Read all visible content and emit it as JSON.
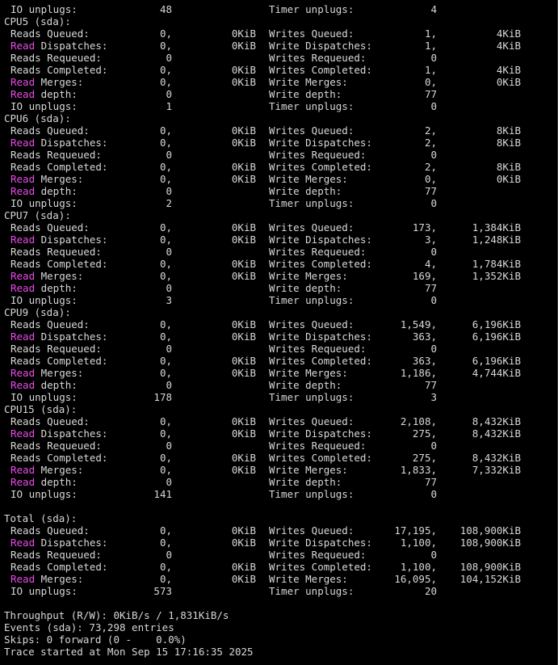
{
  "colors": {
    "background": "#000000",
    "text": "#d8d8d8",
    "highlight": "#e84be8"
  },
  "top_line": {
    "left_label": "IO unplugs:",
    "left_value": "48",
    "right_label": "Timer unplugs:",
    "right_value": "4"
  },
  "cpu_blocks": [
    {
      "header": "CPU5 (sda):",
      "rows": [
        {
          "lead": "Reads Queued:",
          "v": "0,",
          "s": "0KiB",
          "wlabel": "Writes Queued:",
          "wv": "1,",
          "ws": "4KiB"
        },
        {
          "hl": "Read",
          "lead": " Dispatches:",
          "v": "0,",
          "s": "0KiB",
          "wlabel": "Write Dispatches:",
          "wv": "1,",
          "ws": "4KiB"
        },
        {
          "lead": "Reads Requeued:",
          "v": "0",
          "s": "",
          "wlabel": "Writes Requeued:",
          "wv": "0",
          "ws": ""
        },
        {
          "lead": "Reads Completed:",
          "v": "0,",
          "s": "0KiB",
          "wlabel": "Writes Completed:",
          "wv": "1,",
          "ws": "4KiB"
        },
        {
          "hl": "Read",
          "lead": " Merges:",
          "v": "0,",
          "s": "0KiB",
          "wlabel": "Write Merges:",
          "wv": "0,",
          "ws": "0KiB"
        },
        {
          "hl": "Read",
          "lead": " depth:",
          "v": "0",
          "s": "",
          "wlabel": "Write depth:",
          "wv": "77",
          "ws": ""
        },
        {
          "lead": "IO unplugs:",
          "v": "1",
          "s": "",
          "wlabel": "Timer unplugs:",
          "wv": "0",
          "ws": ""
        }
      ]
    },
    {
      "header": "CPU6 (sda):",
      "rows": [
        {
          "lead": "Reads Queued:",
          "v": "0,",
          "s": "0KiB",
          "wlabel": "Writes Queued:",
          "wv": "2,",
          "ws": "8KiB"
        },
        {
          "hl": "Read",
          "lead": " Dispatches:",
          "v": "0,",
          "s": "0KiB",
          "wlabel": "Write Dispatches:",
          "wv": "2,",
          "ws": "8KiB"
        },
        {
          "lead": "Reads Requeued:",
          "v": "0",
          "s": "",
          "wlabel": "Writes Requeued:",
          "wv": "0",
          "ws": ""
        },
        {
          "lead": "Reads Completed:",
          "v": "0,",
          "s": "0KiB",
          "wlabel": "Writes Completed:",
          "wv": "2,",
          "ws": "8KiB"
        },
        {
          "hl": "Read",
          "lead": " Merges:",
          "v": "0,",
          "s": "0KiB",
          "wlabel": "Write Merges:",
          "wv": "0,",
          "ws": "0KiB"
        },
        {
          "hl": "Read",
          "lead": " depth:",
          "v": "0",
          "s": "",
          "wlabel": "Write depth:",
          "wv": "77",
          "ws": ""
        },
        {
          "lead": "IO unplugs:",
          "v": "2",
          "s": "",
          "wlabel": "Timer unplugs:",
          "wv": "0",
          "ws": ""
        }
      ]
    },
    {
      "header": "CPU7 (sda):",
      "rows": [
        {
          "lead": "Reads Queued:",
          "v": "0,",
          "s": "0KiB",
          "wlabel": "Writes Queued:",
          "wv": "173,",
          "ws": "1,384KiB"
        },
        {
          "hl": "Read",
          "lead": " Dispatches:",
          "v": "0,",
          "s": "0KiB",
          "wlabel": "Write Dispatches:",
          "wv": "3,",
          "ws": "1,248KiB"
        },
        {
          "lead": "Reads Requeued:",
          "v": "0",
          "s": "",
          "wlabel": "Writes Requeued:",
          "wv": "0",
          "ws": ""
        },
        {
          "lead": "Reads Completed:",
          "v": "0,",
          "s": "0KiB",
          "wlabel": "Writes Completed:",
          "wv": "4,",
          "ws": "1,784KiB"
        },
        {
          "hl": "Read",
          "lead": " Merges:",
          "v": "0,",
          "s": "0KiB",
          "wlabel": "Write Merges:",
          "wv": "169,",
          "ws": "1,352KiB"
        },
        {
          "hl": "Read",
          "lead": " depth:",
          "v": "0",
          "s": "",
          "wlabel": "Write depth:",
          "wv": "77",
          "ws": ""
        },
        {
          "lead": "IO unplugs:",
          "v": "3",
          "s": "",
          "wlabel": "Timer unplugs:",
          "wv": "0",
          "ws": ""
        }
      ]
    },
    {
      "header": "CPU9 (sda):",
      "rows": [
        {
          "lead": "Reads Queued:",
          "v": "0,",
          "s": "0KiB",
          "wlabel": "Writes Queued:",
          "wv": "1,549,",
          "ws": "6,196KiB"
        },
        {
          "hl": "Read",
          "lead": " Dispatches:",
          "v": "0,",
          "s": "0KiB",
          "wlabel": "Write Dispatches:",
          "wv": "363,",
          "ws": "6,196KiB"
        },
        {
          "lead": "Reads Requeued:",
          "v": "0",
          "s": "",
          "wlabel": "Writes Requeued:",
          "wv": "0",
          "ws": ""
        },
        {
          "lead": "Reads Completed:",
          "v": "0,",
          "s": "0KiB",
          "wlabel": "Writes Completed:",
          "wv": "363,",
          "ws": "6,196KiB"
        },
        {
          "hl": "Read",
          "lead": " Merges:",
          "v": "0,",
          "s": "0KiB",
          "wlabel": "Write Merges:",
          "wv": "1,186,",
          "ws": "4,744KiB"
        },
        {
          "hl": "Read",
          "lead": " depth:",
          "v": "0",
          "s": "",
          "wlabel": "Write depth:",
          "wv": "77",
          "ws": ""
        },
        {
          "lead": "IO unplugs:",
          "v": "178",
          "s": "",
          "wlabel": "Timer unplugs:",
          "wv": "3",
          "ws": ""
        }
      ]
    },
    {
      "header": "CPU15 (sda):",
      "rows": [
        {
          "lead": "Reads Queued:",
          "v": "0,",
          "s": "0KiB",
          "wlabel": "Writes Queued:",
          "wv": "2,108,",
          "ws": "8,432KiB"
        },
        {
          "hl": "Read",
          "lead": " Dispatches:",
          "v": "0,",
          "s": "0KiB",
          "wlabel": "Write Dispatches:",
          "wv": "275,",
          "ws": "8,432KiB"
        },
        {
          "lead": "Reads Requeued:",
          "v": "0",
          "s": "",
          "wlabel": "Writes Requeued:",
          "wv": "0",
          "ws": ""
        },
        {
          "lead": "Reads Completed:",
          "v": "0,",
          "s": "0KiB",
          "wlabel": "Writes Completed:",
          "wv": "275,",
          "ws": "8,432KiB"
        },
        {
          "hl": "Read",
          "lead": " Merges:",
          "v": "0,",
          "s": "0KiB",
          "wlabel": "Write Merges:",
          "wv": "1,833,",
          "ws": "7,332KiB"
        },
        {
          "hl": "Read",
          "lead": " depth:",
          "v": "0",
          "s": "",
          "wlabel": "Write depth:",
          "wv": "77",
          "ws": ""
        },
        {
          "lead": "IO unplugs:",
          "v": "141",
          "s": "",
          "wlabel": "Timer unplugs:",
          "wv": "0",
          "ws": ""
        }
      ]
    }
  ],
  "total_block": {
    "header": "Total (sda):",
    "rows": [
      {
        "lead": "Reads Queued:",
        "v": "0,",
        "s": "0KiB",
        "wlabel": "Writes Queued:",
        "wv": "17,195,",
        "ws": "108,900KiB"
      },
      {
        "hl": "Read",
        "lead": " Dispatches:",
        "v": "0,",
        "s": "0KiB",
        "wlabel": "Write Dispatches:",
        "wv": "1,100,",
        "ws": "108,900KiB"
      },
      {
        "lead": "Reads Requeued:",
        "v": "0",
        "s": "",
        "wlabel": "Writes Requeued:",
        "wv": "0",
        "ws": ""
      },
      {
        "lead": "Reads Completed:",
        "v": "0,",
        "s": "0KiB",
        "wlabel": "Writes Completed:",
        "wv": "1,100,",
        "ws": "108,900KiB"
      },
      {
        "hl": "Read",
        "lead": " Merges:",
        "v": "0,",
        "s": "0KiB",
        "wlabel": "Write Merges:",
        "wv": "16,095,",
        "ws": "104,152KiB"
      },
      {
        "lead": "IO unplugs:",
        "v": "573",
        "s": "",
        "wlabel": "Timer unplugs:",
        "wv": "20",
        "ws": ""
      }
    ]
  },
  "footer": [
    "Throughput (R/W): 0KiB/s / 1,831KiB/s",
    "Events (sda): 73,298 entries",
    "Skips: 0 forward (0 -    0.0%)",
    "Trace started at Mon Sep 15 17:16:35 2025"
  ]
}
